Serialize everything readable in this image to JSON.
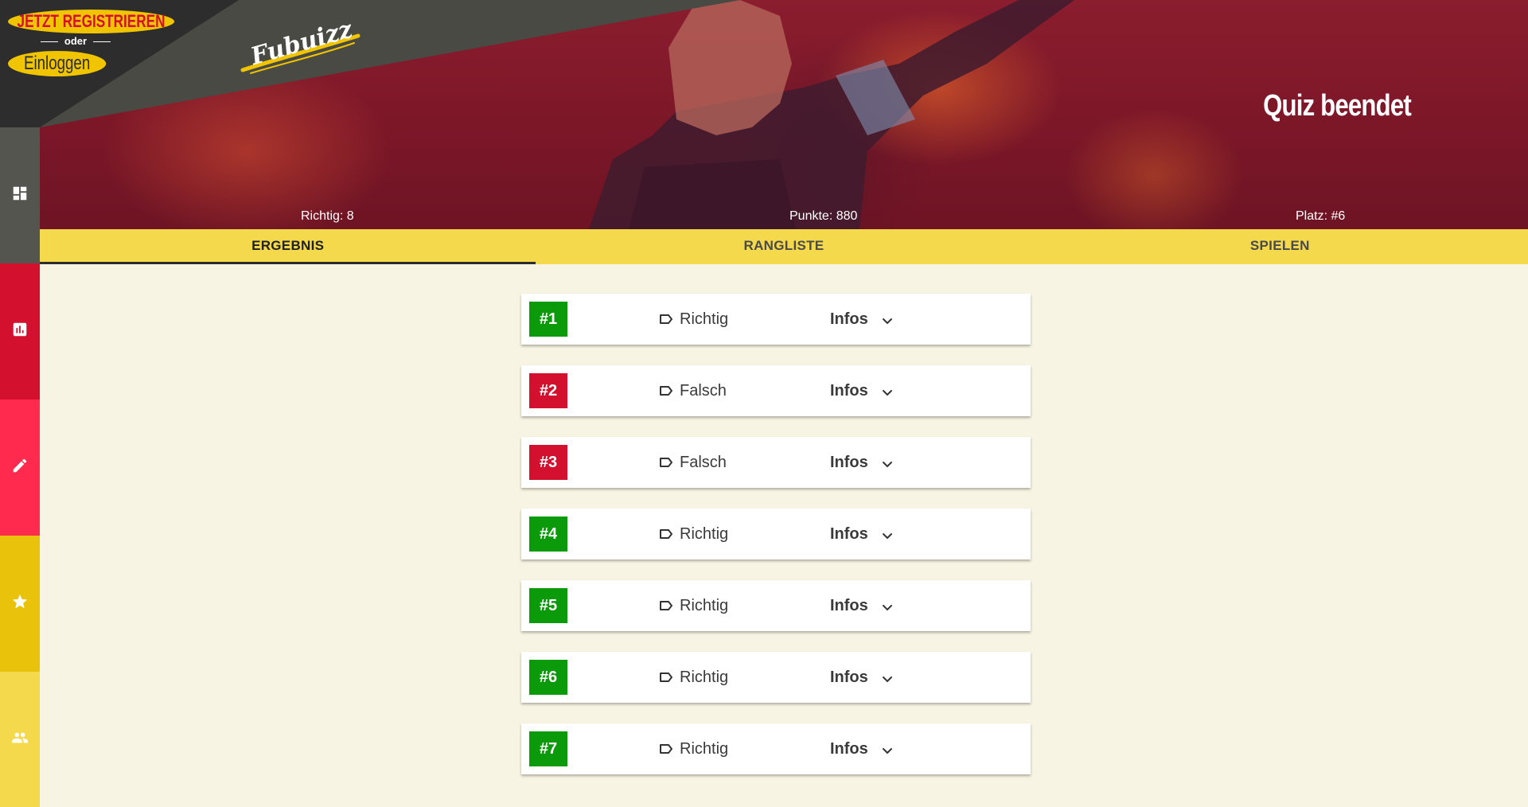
{
  "auth": {
    "register_label": "JETZT REGISTRIEREN",
    "or_label": "oder",
    "login_label": "Einloggen"
  },
  "logo_text": "Fubuizz",
  "sidebar": {
    "items": [
      {
        "icon": "dashboard-icon",
        "color": "#555550"
      },
      {
        "icon": "bar-chart-icon",
        "color": "#d4102f"
      },
      {
        "icon": "pencil-icon",
        "color": "#ff2a4d"
      },
      {
        "icon": "star-icon",
        "color": "#e9c20c"
      },
      {
        "icon": "people-icon",
        "color": "#f4d94c"
      }
    ]
  },
  "hero": {
    "title": "Quiz beendet",
    "richtig": "Richtig: 8",
    "punkte": "Punkte: 880",
    "platz": "Platz: #6"
  },
  "tabs": [
    {
      "label": "ERGEBNIS",
      "active": true
    },
    {
      "label": "RANGLISTE",
      "active": false
    },
    {
      "label": "SPIELEN",
      "active": false
    }
  ],
  "results": [
    {
      "number": "#1",
      "verdict": "Richtig",
      "correct": true,
      "infos": "Infos"
    },
    {
      "number": "#2",
      "verdict": "Falsch",
      "correct": false,
      "infos": "Infos"
    },
    {
      "number": "#3",
      "verdict": "Falsch",
      "correct": false,
      "infos": "Infos"
    },
    {
      "number": "#4",
      "verdict": "Richtig",
      "correct": true,
      "infos": "Infos"
    },
    {
      "number": "#5",
      "verdict": "Richtig",
      "correct": true,
      "infos": "Infos"
    },
    {
      "number": "#6",
      "verdict": "Richtig",
      "correct": true,
      "infos": "Infos"
    },
    {
      "number": "#7",
      "verdict": "Richtig",
      "correct": true,
      "infos": "Infos"
    }
  ],
  "colors": {
    "correct": "#0a9a0a",
    "wrong": "#d4102f",
    "accent_yellow": "#f4d94c",
    "background": "#f8f4e3"
  }
}
